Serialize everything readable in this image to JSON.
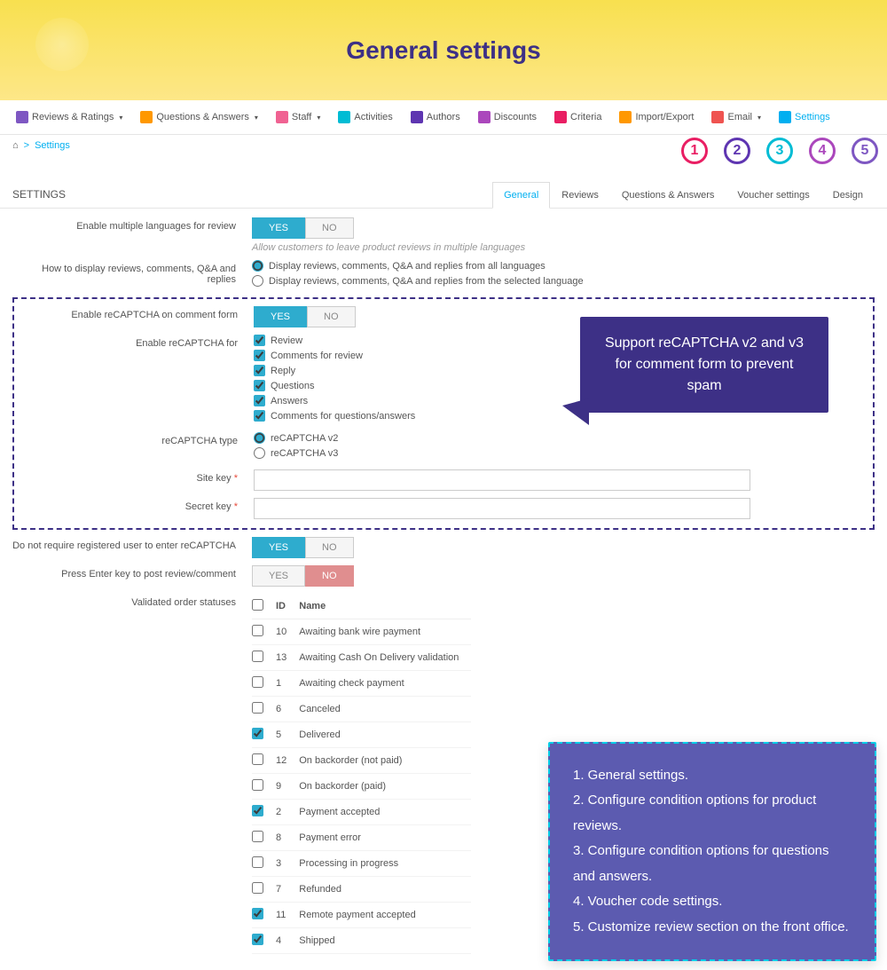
{
  "header": {
    "title": "General settings"
  },
  "topnav": {
    "items": [
      {
        "label": "Reviews & Ratings",
        "chev": true
      },
      {
        "label": "Questions & Answers",
        "chev": true
      },
      {
        "label": "Staff",
        "chev": true
      },
      {
        "label": "Activities",
        "chev": false
      },
      {
        "label": "Authors",
        "chev": false
      },
      {
        "label": "Discounts",
        "chev": false
      },
      {
        "label": "Criteria",
        "chev": false
      },
      {
        "label": "Import/Export",
        "chev": false
      },
      {
        "label": "Email",
        "chev": true
      },
      {
        "label": "Settings",
        "chev": false,
        "active": true
      }
    ]
  },
  "breadcrumb": {
    "home": "⌂",
    "sep": ">",
    "current": "Settings"
  },
  "panel": {
    "title": "SETTINGS",
    "tabs": [
      "General",
      "Reviews",
      "Questions & Answers",
      "Voucher settings",
      "Design"
    ],
    "activeTab": 0
  },
  "badges": [
    "1",
    "2",
    "3",
    "4",
    "5"
  ],
  "fields": {
    "enableLang": {
      "label": "Enable multiple languages for review",
      "yes": "YES",
      "no": "NO",
      "help": "Allow customers to leave product reviews in multiple languages"
    },
    "displayHow": {
      "label": "How to display reviews, comments, Q&A and replies",
      "opt1": "Display reviews, comments, Q&A and replies from all languages",
      "opt2": "Display reviews, comments, Q&A and replies from the selected language"
    },
    "enableRecap": {
      "label": "Enable reCAPTCHA on comment form",
      "yes": "YES",
      "no": "NO"
    },
    "recapFor": {
      "label": "Enable reCAPTCHA for",
      "opts": [
        "Review",
        "Comments for review",
        "Reply",
        "Questions",
        "Answers",
        "Comments for questions/answers"
      ]
    },
    "recapType": {
      "label": "reCAPTCHA type",
      "opt1": "reCAPTCHA v2",
      "opt2": "reCAPTCHA v3"
    },
    "siteKey": {
      "label": "Site key"
    },
    "secretKey": {
      "label": "Secret key"
    },
    "noRecapReg": {
      "label": "Do not require registered user to enter reCAPTCHA",
      "yes": "YES",
      "no": "NO"
    },
    "pressEnter": {
      "label": "Press Enter key to post review/comment",
      "yes": "YES",
      "no": "NO"
    },
    "validStatuses": {
      "label": "Validated order statuses",
      "cols": [
        "ID",
        "Name"
      ],
      "rows": [
        {
          "id": "10",
          "name": "Awaiting bank wire payment",
          "checked": false
        },
        {
          "id": "13",
          "name": "Awaiting Cash On Delivery validation",
          "checked": false
        },
        {
          "id": "1",
          "name": "Awaiting check payment",
          "checked": false
        },
        {
          "id": "6",
          "name": "Canceled",
          "checked": false
        },
        {
          "id": "5",
          "name": "Delivered",
          "checked": true
        },
        {
          "id": "12",
          "name": "On backorder (not paid)",
          "checked": false
        },
        {
          "id": "9",
          "name": "On backorder (paid)",
          "checked": false
        },
        {
          "id": "2",
          "name": "Payment accepted",
          "checked": true
        },
        {
          "id": "8",
          "name": "Payment error",
          "checked": false
        },
        {
          "id": "3",
          "name": "Processing in progress",
          "checked": false
        },
        {
          "id": "7",
          "name": "Refunded",
          "checked": false
        },
        {
          "id": "11",
          "name": "Remote payment accepted",
          "checked": true
        },
        {
          "id": "4",
          "name": "Shipped",
          "checked": true
        }
      ]
    }
  },
  "callout": "Support reCAPTCHA v2 and v3 for comment form to prevent spam",
  "infocard": {
    "l1": "1. General settings.",
    "l2": "2. Configure condition options for product reviews.",
    "l3": "3. Configure condition options for questions and answers.",
    "l4": "4. Voucher code settings.",
    "l5": "5. Customize review section on the front office."
  },
  "asterisk": "*"
}
